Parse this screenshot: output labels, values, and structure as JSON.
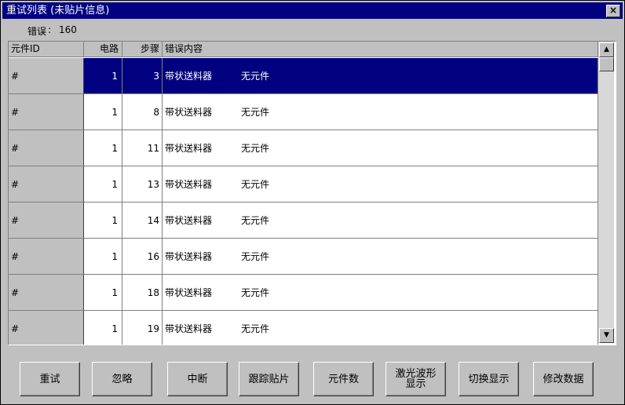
{
  "window": {
    "title": "重试列表 (未贴片信息)",
    "close_label": "×"
  },
  "errors": {
    "label": "错误",
    "separator": ":",
    "count": "160"
  },
  "table": {
    "headers": [
      "元件ID",
      "电路",
      "步骤",
      "错误内容"
    ],
    "rows": [
      {
        "id": "#",
        "circuit": "1",
        "step": "3",
        "error_source": "带状送料器",
        "error_text": "无元件",
        "selected": true
      },
      {
        "id": "#",
        "circuit": "1",
        "step": "8",
        "error_source": "带状送料器",
        "error_text": "无元件",
        "selected": false
      },
      {
        "id": "#",
        "circuit": "1",
        "step": "11",
        "error_source": "带状送料器",
        "error_text": "无元件",
        "selected": false
      },
      {
        "id": "#",
        "circuit": "1",
        "step": "13",
        "error_source": "带状送料器",
        "error_text": "无元件",
        "selected": false
      },
      {
        "id": "#",
        "circuit": "1",
        "step": "14",
        "error_source": "带状送料器",
        "error_text": "无元件",
        "selected": false
      },
      {
        "id": "#",
        "circuit": "1",
        "step": "16",
        "error_source": "带状送料器",
        "error_text": "无元件",
        "selected": false
      },
      {
        "id": "#",
        "circuit": "1",
        "step": "18",
        "error_source": "带状送料器",
        "error_text": "无元件",
        "selected": false
      },
      {
        "id": "#",
        "circuit": "1",
        "step": "19",
        "error_source": "带状送料器",
        "error_text": "无元件",
        "selected": false
      }
    ]
  },
  "scrollbar": {
    "up_arrow": "▲",
    "down_arrow": "▼"
  },
  "buttons": {
    "retry": "重试",
    "ignore": "忽略",
    "abort": "中断",
    "trace": "跟踪贴片",
    "part_count": "元件数",
    "laser_line1": "激光波形",
    "laser_line2": "显示",
    "toggle_display": "切换显示",
    "modify_data": "修改数据"
  },
  "colors": {
    "title_bar": "#000080",
    "selection": "#000080",
    "face": "#c0c0c0"
  }
}
